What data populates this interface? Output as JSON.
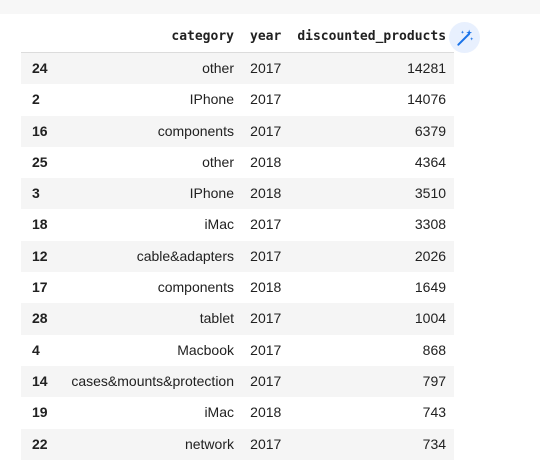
{
  "table": {
    "columns": [
      "",
      "category",
      "year",
      "discounted_products"
    ],
    "rows": [
      {
        "index": "24",
        "category": "other",
        "year": "2017",
        "discounted_products": "14281"
      },
      {
        "index": "2",
        "category": "IPhone",
        "year": "2017",
        "discounted_products": "14076"
      },
      {
        "index": "16",
        "category": "components",
        "year": "2017",
        "discounted_products": "6379"
      },
      {
        "index": "25",
        "category": "other",
        "year": "2018",
        "discounted_products": "4364"
      },
      {
        "index": "3",
        "category": "IPhone",
        "year": "2018",
        "discounted_products": "3510"
      },
      {
        "index": "18",
        "category": "iMac",
        "year": "2017",
        "discounted_products": "3308"
      },
      {
        "index": "12",
        "category": "cable&adapters",
        "year": "2017",
        "discounted_products": "2026"
      },
      {
        "index": "17",
        "category": "components",
        "year": "2018",
        "discounted_products": "1649"
      },
      {
        "index": "28",
        "category": "tablet",
        "year": "2017",
        "discounted_products": "1004"
      },
      {
        "index": "4",
        "category": "Macbook",
        "year": "2017",
        "discounted_products": "868"
      },
      {
        "index": "14",
        "category": "cases&mounts&protection",
        "year": "2017",
        "discounted_products": "797"
      },
      {
        "index": "19",
        "category": "iMac",
        "year": "2018",
        "discounted_products": "743"
      },
      {
        "index": "22",
        "category": "network",
        "year": "2017",
        "discounted_products": "734"
      }
    ]
  },
  "toolbar": {
    "magic_icon": "magic-wand-icon",
    "accent_color": "#1a73e8",
    "button_bg": "#e8f0fe"
  }
}
